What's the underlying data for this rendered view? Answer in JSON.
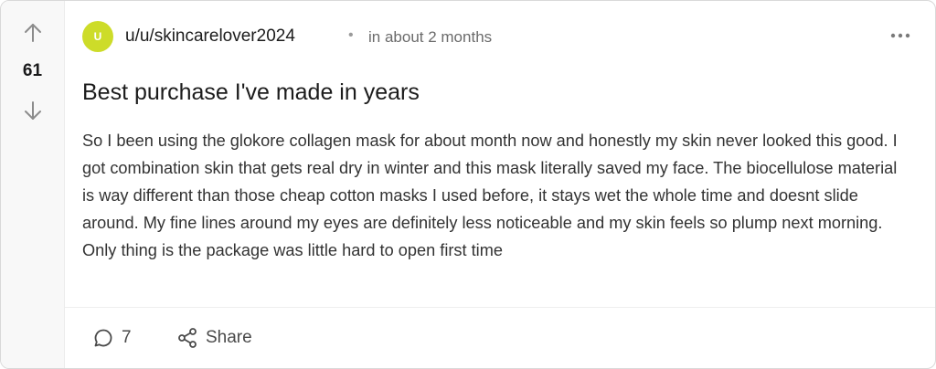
{
  "post": {
    "score": "61",
    "avatar_letter": "U",
    "username": "u/u/skincarelover2024",
    "separator": "•",
    "timestamp": "in about 2 months",
    "title": "Best purchase I've made in years",
    "body": "So I been using the glokore collagen mask for about month now and honestly my skin never looked this good. I got combination skin that gets real dry in winter and this mask literally saved my face. The biocellulose material is way different than those cheap cotton masks I used before, it stays wet the whole time and doesnt slide around. My fine lines around my eyes are definitely less noticeable and my skin feels so plump next morning. Only thing is the package was little hard to open first time"
  },
  "actions": {
    "comments_count": "7",
    "share_label": "Share"
  },
  "icons": {
    "upvote": "arrow-up-icon",
    "downvote": "arrow-down-icon",
    "more": "more-horizontal-icon",
    "comment": "comment-icon",
    "share": "share-icon"
  },
  "colors": {
    "avatar": "#cddc29",
    "vote_column": "#f8f8f8",
    "border": "#d9d9d9"
  }
}
